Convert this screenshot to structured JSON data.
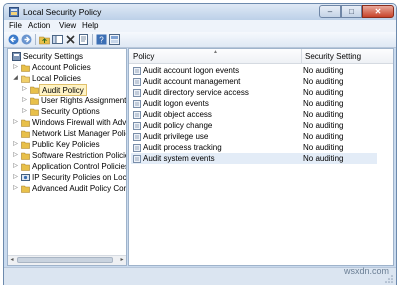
{
  "window": {
    "title": "Local Security Policy",
    "min_glyph": "‒",
    "max_glyph": "□",
    "close_glyph": "✕"
  },
  "menubar": {
    "items": [
      "File",
      "Action",
      "View",
      "Help"
    ]
  },
  "toolbar": {
    "icons": [
      "back-arrow-icon",
      "forward-arrow-icon",
      "up-folder-icon",
      "show-hide-tree-icon",
      "delete-icon",
      "properties-icon",
      "export-list-icon",
      "help-icon",
      "console-icon"
    ]
  },
  "tree": {
    "root": "Security Settings",
    "nodes": [
      {
        "label": "Account Policies"
      },
      {
        "label": "Local Policies"
      },
      {
        "label": "Audit Policy"
      },
      {
        "label": "User Rights Assignment"
      },
      {
        "label": "Security Options"
      },
      {
        "label": "Windows Firewall with Advanc"
      },
      {
        "label": "Network List Manager Policies"
      },
      {
        "label": "Public Key Policies"
      },
      {
        "label": "Software Restriction Policies"
      },
      {
        "label": "Application Control Policies"
      },
      {
        "label": "IP Security Policies on Local C"
      },
      {
        "label": "Advanced Audit Policy Configu"
      }
    ],
    "expand_collapsed": "▷",
    "expand_open": "◢",
    "scroll_left": "◂",
    "scroll_right": "▸"
  },
  "list": {
    "columns": {
      "policy": "Policy",
      "setting": "Security Setting"
    },
    "sort_indicator": "▲",
    "rows": [
      {
        "policy": "Audit account logon events",
        "setting": "No auditing"
      },
      {
        "policy": "Audit account management",
        "setting": "No auditing"
      },
      {
        "policy": "Audit directory service access",
        "setting": "No auditing"
      },
      {
        "policy": "Audit logon events",
        "setting": "No auditing"
      },
      {
        "policy": "Audit object access",
        "setting": "No auditing"
      },
      {
        "policy": "Audit policy change",
        "setting": "No auditing"
      },
      {
        "policy": "Audit privilege use",
        "setting": "No auditing"
      },
      {
        "policy": "Audit process tracking",
        "setting": "No auditing"
      },
      {
        "policy": "Audit system events",
        "setting": "No auditing"
      }
    ],
    "selected_row": 8
  },
  "watermark": "wsxdn.com",
  "colors": {
    "accent": "#c9daee",
    "selection": "#fff3c4",
    "folder": "#e8c04a"
  }
}
